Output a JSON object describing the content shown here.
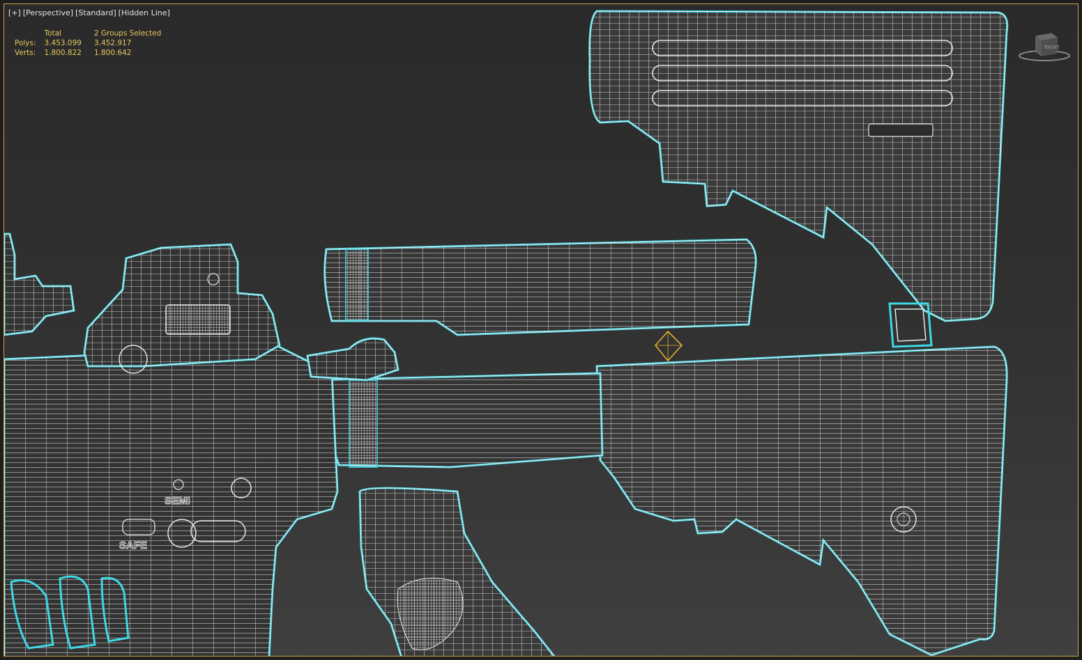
{
  "viewport": {
    "labels": [
      "[+]",
      "[Perspective]",
      "[Standard]",
      "[Hidden Line]"
    ]
  },
  "stats": {
    "headers": [
      "",
      "Total",
      "2 Groups Selected"
    ],
    "rows": [
      {
        "label": "Polys:",
        "total": "3.453.099",
        "selected": "3.452.917"
      },
      {
        "label": "Verts:",
        "total": "1.800.822",
        "selected": "1.800.642"
      }
    ]
  },
  "viewcube": {
    "face_label": "RIGHT"
  },
  "labels": {
    "semi": "SEMI",
    "safe": "SAFE"
  },
  "colors": {
    "outline": "#3fd8e6",
    "wire": "#e8e8e8",
    "stats_text": "#e8c860",
    "pivot": "#e0b030",
    "frame": "#c7a34a"
  }
}
